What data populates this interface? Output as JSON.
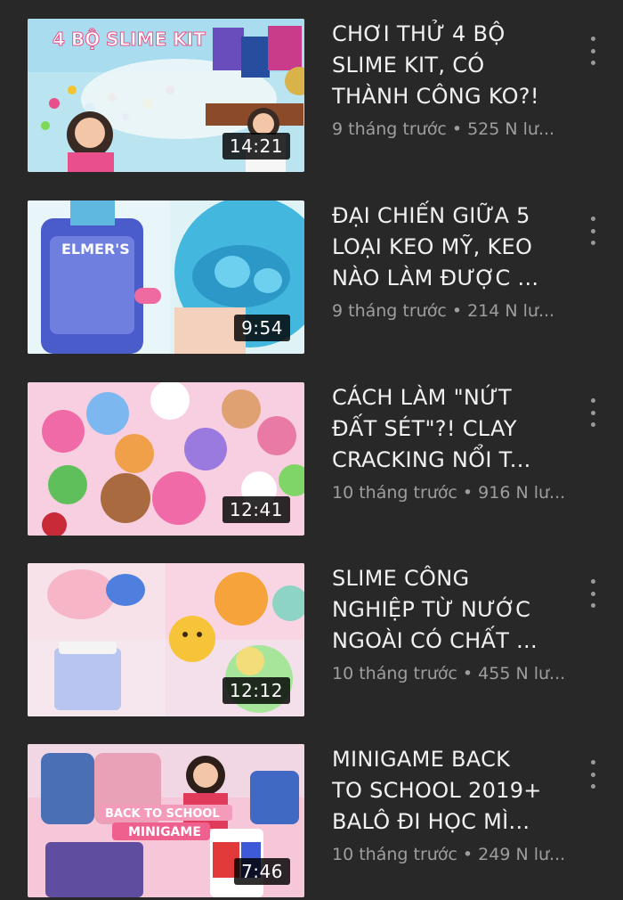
{
  "videos": [
    {
      "title": "CHƠI THỬ 4 BỘ\nSLIME KIT, CÓ\nTHÀNH CÔNG KO?!",
      "meta": "9 tháng trước • 525 N lư...",
      "duration": "14:21",
      "thumb_caption": "4 BỘ SLIME KIT"
    },
    {
      "title": "ĐẠI CHIẾN GIỮA 5\nLOẠI KEO MỸ, KEO\nNÀO LÀM ĐƯỢC ...",
      "meta": "9 tháng trước • 214 N lư...",
      "duration": "9:54",
      "thumb_caption": "ELMER'S"
    },
    {
      "title": "CÁCH LÀM \"NỨT\nĐẤT SÉT\"?! CLAY\nCRACKING NỔI T...",
      "meta": "10 tháng trước • 916 N lư...",
      "duration": "12:41",
      "thumb_caption": ""
    },
    {
      "title": "SLIME CÔNG\nNGHIỆP TỪ NƯỚC\nNGOÀI CÓ CHẤT ...",
      "meta": "10 tháng trước • 455 N lư...",
      "duration": "12:12",
      "thumb_caption": ""
    },
    {
      "title": "MINIGAME BACK\nTO SCHOOL 2019+\nBALÔ ĐI HỌC MÌ...",
      "meta": "10 tháng trước • 249 N lư...",
      "duration": "7:46",
      "thumb_caption_1": "BACK TO SCHOOL",
      "thumb_caption_2": "MINIGAME"
    }
  ],
  "icons": {
    "more": "more-vert-icon"
  }
}
